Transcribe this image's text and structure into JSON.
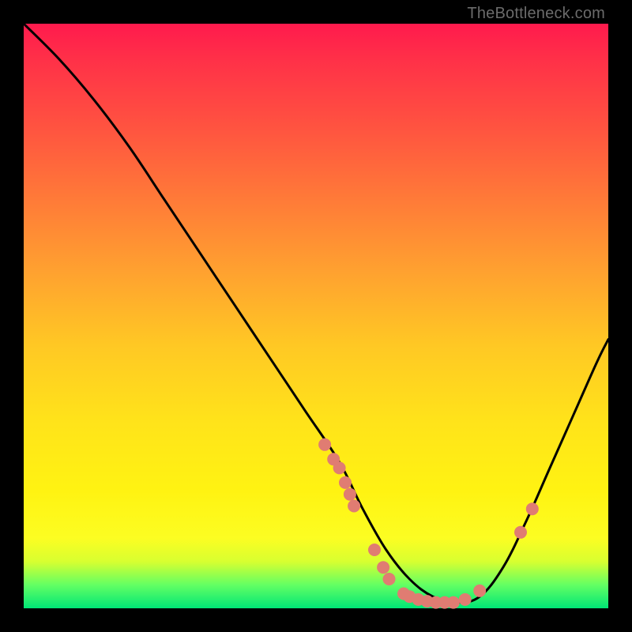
{
  "attribution": "TheBottleneck.com",
  "colors": {
    "curve_stroke": "#000000",
    "marker_fill": "#e07c72",
    "marker_stroke": "#e07c72"
  },
  "chart_data": {
    "type": "line",
    "title": "",
    "xlabel": "",
    "ylabel": "",
    "xlim": [
      0,
      100
    ],
    "ylim": [
      0,
      100
    ],
    "series": [
      {
        "name": "bottleneck-curve",
        "x": [
          0,
          6,
          12,
          18,
          24,
          30,
          36,
          42,
          48,
          54,
          58,
          62,
          66,
          70,
          74,
          78,
          82,
          86,
          90,
          94,
          98,
          100
        ],
        "y": [
          100,
          94,
          87,
          79,
          70,
          61,
          52,
          43,
          34,
          25,
          17,
          10,
          5,
          2,
          1,
          2,
          7,
          15,
          24,
          33,
          42,
          46
        ]
      }
    ],
    "markers": [
      {
        "x": 51.5,
        "y": 28.0
      },
      {
        "x": 53.0,
        "y": 25.5
      },
      {
        "x": 54.0,
        "y": 24.0
      },
      {
        "x": 55.0,
        "y": 21.5
      },
      {
        "x": 55.8,
        "y": 19.5
      },
      {
        "x": 56.5,
        "y": 17.5
      },
      {
        "x": 60.0,
        "y": 10.0
      },
      {
        "x": 61.5,
        "y": 7.0
      },
      {
        "x": 62.5,
        "y": 5.0
      },
      {
        "x": 65.0,
        "y": 2.5
      },
      {
        "x": 66.0,
        "y": 2.0
      },
      {
        "x": 67.5,
        "y": 1.5
      },
      {
        "x": 69.0,
        "y": 1.2
      },
      {
        "x": 70.5,
        "y": 1.0
      },
      {
        "x": 72.0,
        "y": 1.0
      },
      {
        "x": 73.5,
        "y": 1.0
      },
      {
        "x": 75.5,
        "y": 1.5
      },
      {
        "x": 78.0,
        "y": 3.0
      },
      {
        "x": 85.0,
        "y": 13.0
      },
      {
        "x": 87.0,
        "y": 17.0
      }
    ]
  }
}
